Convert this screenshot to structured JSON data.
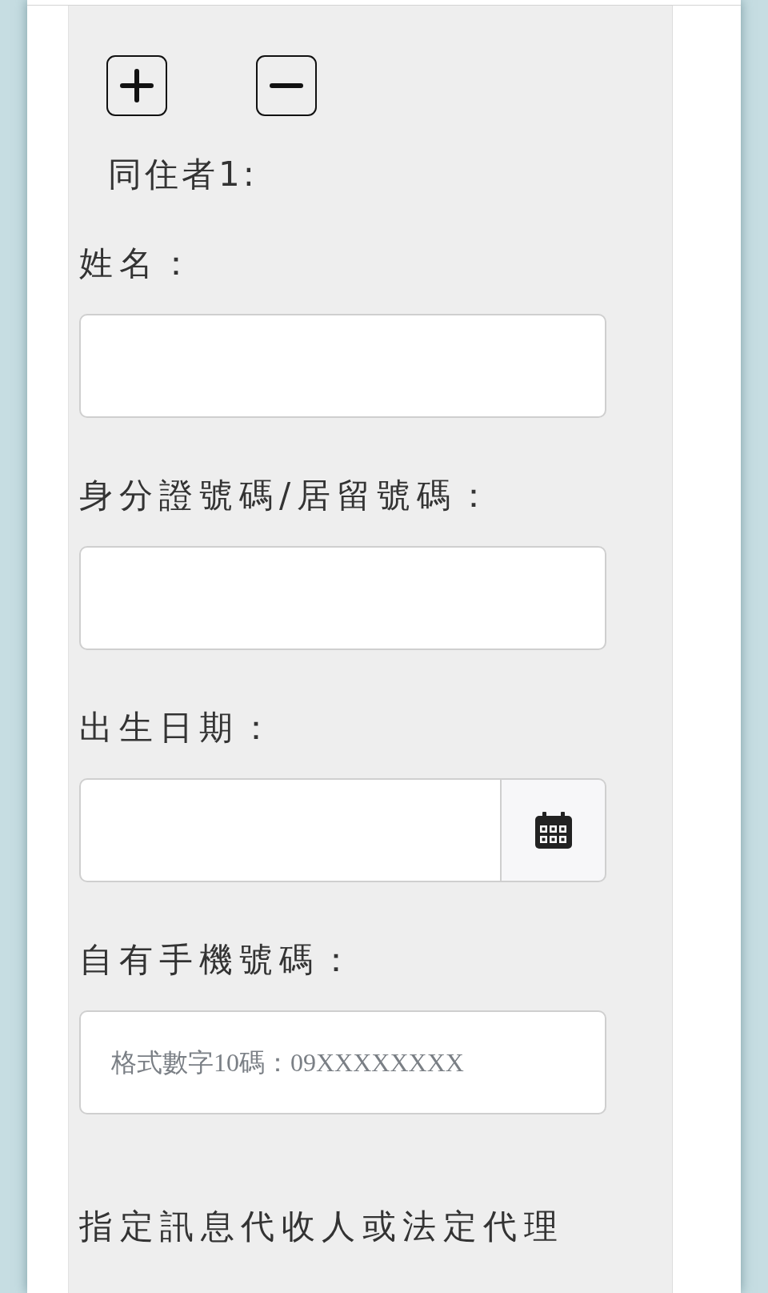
{
  "row_buttons": [
    {
      "kind": "add"
    },
    {
      "kind": "remove"
    }
  ],
  "occupant_label": "同住者1:",
  "fields": [
    {
      "kind": "text",
      "label": "姓名："
    },
    {
      "kind": "text",
      "label": "身分證號碼/居留號碼："
    },
    {
      "kind": "date",
      "label": "出生日期："
    },
    {
      "kind": "text",
      "label": "自有手機號碼：",
      "placeholder": "格式數字10碼：09XXXXXXXX"
    }
  ],
  "agent_label": "指定訊息代收人或法定代理"
}
